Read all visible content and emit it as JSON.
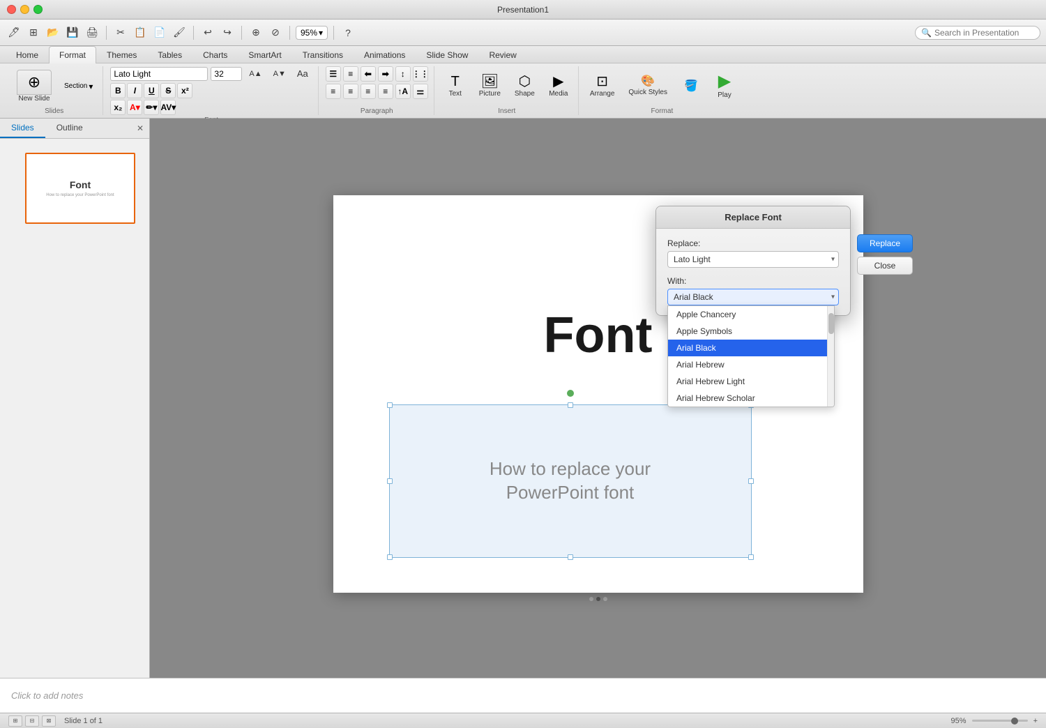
{
  "window": {
    "title": "Presentation1",
    "buttons": [
      "close",
      "minimize",
      "maximize"
    ]
  },
  "toolbar": {
    "zoom": "95%",
    "search_placeholder": "Search in Presentation"
  },
  "ribbon": {
    "tabs": [
      {
        "id": "home",
        "label": "Home",
        "active": false
      },
      {
        "id": "format",
        "label": "Format",
        "active": true
      },
      {
        "id": "themes",
        "label": "Themes",
        "active": false
      },
      {
        "id": "tables",
        "label": "Tables",
        "active": false
      },
      {
        "id": "charts",
        "label": "Charts",
        "active": false
      },
      {
        "id": "smartart",
        "label": "SmartArt",
        "active": false
      },
      {
        "id": "transitions",
        "label": "Transitions",
        "active": false
      },
      {
        "id": "animations",
        "label": "Animations",
        "active": false
      },
      {
        "id": "slideshow",
        "label": "Slide Show",
        "active": false
      },
      {
        "id": "review",
        "label": "Review",
        "active": false
      }
    ],
    "font_name": "Lato Light",
    "font_size": "32",
    "groups": [
      {
        "id": "slides",
        "label": "Slides"
      },
      {
        "id": "font",
        "label": "Font"
      },
      {
        "id": "paragraph",
        "label": "Paragraph"
      },
      {
        "id": "insert",
        "label": "Insert"
      },
      {
        "id": "format",
        "label": "Format"
      }
    ],
    "buttons": {
      "new_slide": "New Slide",
      "section": "Section",
      "text": "Text",
      "picture": "Picture",
      "shape": "Shape",
      "media": "Media",
      "arrange": "Arrange",
      "quick_styles": "Quick Styles",
      "play": "Play"
    }
  },
  "slides_panel": {
    "tabs": [
      {
        "id": "slides",
        "label": "Slides",
        "active": true
      },
      {
        "id": "outline",
        "label": "Outline",
        "active": false
      }
    ],
    "slide_count": 1,
    "thumbnail": {
      "title": "Font",
      "subtitle": "How to replace your PowerPoint font"
    }
  },
  "slide": {
    "title": "Font",
    "body_text_line1": "How to replace your",
    "body_text_line2": "PowerPoint font"
  },
  "notes": {
    "placeholder": "Click to add notes"
  },
  "status_bar": {
    "slide_info": "Slide 1 of 1",
    "zoom": "95%"
  },
  "dialog": {
    "title": "Replace Font",
    "replace_label": "Replace:",
    "replace_value": "Lato Light",
    "with_label": "With:",
    "with_value": "Arial Black",
    "replace_btn": "Replace",
    "close_btn": "Close",
    "dropdown_items": [
      {
        "label": "Apple Chancery",
        "selected": false
      },
      {
        "label": "Apple Symbols",
        "selected": false
      },
      {
        "label": "Arial Black",
        "selected": true
      },
      {
        "label": "Arial Hebrew",
        "selected": false
      },
      {
        "label": "Arial Hebrew Light",
        "selected": false
      },
      {
        "label": "Arial Hebrew Scholar",
        "selected": false
      }
    ]
  }
}
